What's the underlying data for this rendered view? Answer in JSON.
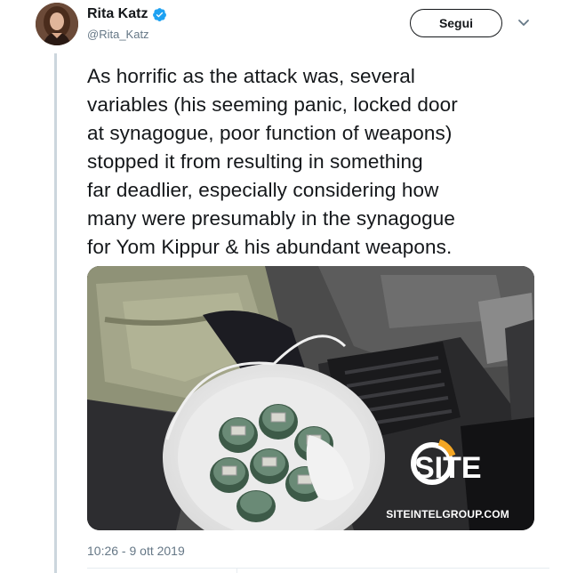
{
  "author": {
    "display_name": "Rita Katz",
    "handle": "@Rita_Katz",
    "verified": true,
    "avatar_icon": "profile-photo"
  },
  "actions": {
    "follow_label": "Segui",
    "more_icon": "chevron-down-icon"
  },
  "tweet": {
    "text": "As horrific as the attack was, several\nvariables (his seeming panic, locked door\nat synagogue, poor function of weapons)\nstopped it from resulting in something\nfar deadlier, especially considering how\nmany were presumably in the synagogue\nfor Yom Kippur & his abundant weapons.",
    "timestamp": "10:26 - 9 ott 2019"
  },
  "media": {
    "watermark_logo": "SITE",
    "watermark_text": "SITEINTELGROUP.COM"
  },
  "colors": {
    "accent": "#1da1f2",
    "text": "#14171a",
    "muted": "#657786",
    "thread_line": "#ccd6dd"
  }
}
